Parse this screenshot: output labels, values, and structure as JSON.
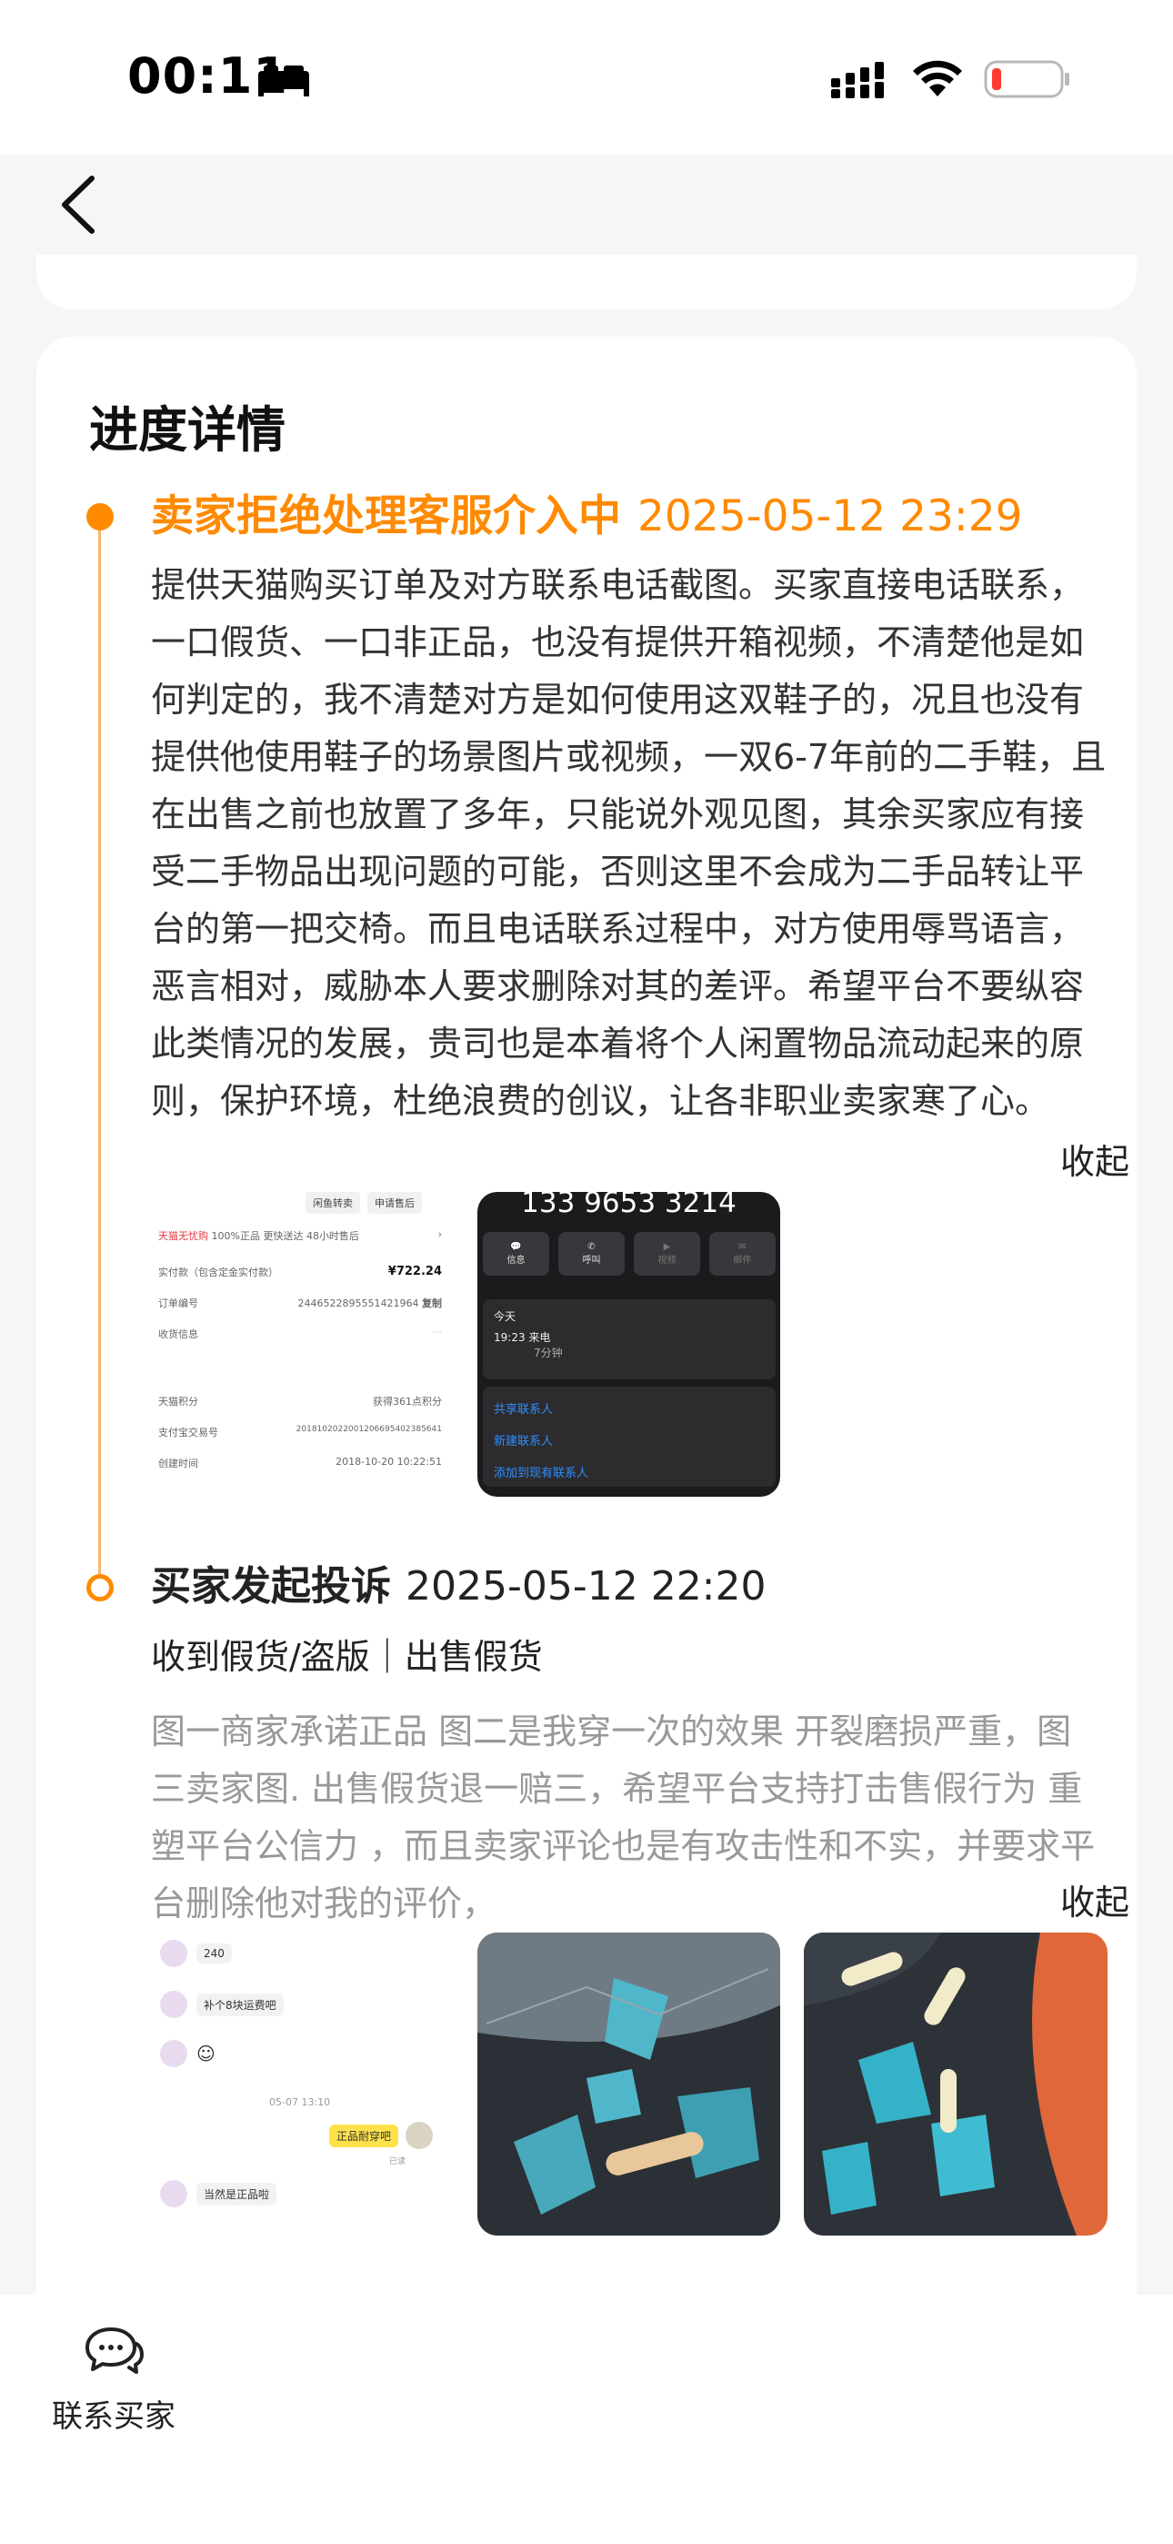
{
  "status_bar": {
    "time": "00:11"
  },
  "section": {
    "title": "进度详情"
  },
  "events": [
    {
      "title": "卖家拒绝处理客服介入中",
      "date": "2025-05-12 23:29",
      "body": "提供天猫购买订单及对方联系电话截图。买家直接电话联系，一口假货、一口非正品，也没有提供开箱视频，不清楚他是如何判定的，我不清楚对方是如何使用这双鞋子的，况且也没有提供他使用鞋子的场景图片或视频，一双6-7年前的二手鞋，且在出售之前也放置了多年，只能说外观见图，其余买家应有接受二手物品出现问题的可能，否则这里不会成为二手品转让平台的第一把交椅。而且电话联系过程中，对方使用辱骂语言，恶言相对，威胁本人要求删除对其的差评。希望平台不要纵容此类情况的发展，贵司也是本着将个人闲置物品流动起来的原则，保护环境，杜绝浪费的创议，让各非职业卖家寒了心。",
      "collapse_label": "收起",
      "order_thumb": {
        "tab_1": "闲鱼转卖",
        "tab_2": "申请售后",
        "shop": "天猫无忧购",
        "shop_note": "100%正品 更快送达 48小时售后",
        "paid_label": "实付款（包含定金实付款）",
        "paid_value": "¥722.24",
        "order_no_label": "订单编号",
        "order_no_value": "2446522895551421964",
        "copy": "复制",
        "address_label": "收货信息",
        "points_label": "天猫积分",
        "points_value": "获得361点积分",
        "alipay_label": "支付宝交易号",
        "alipay_value": "2018102022001206695402385641",
        "created_label": "创建时间",
        "created_value": "2018-10-20 10:22:51"
      },
      "phone_thumb": {
        "number": "133 9653 3214",
        "btn_message": "信息",
        "btn_call": "呼叫",
        "btn_video": "视频",
        "btn_mail": "邮件",
        "today": "今天",
        "call_time": "19:23",
        "call_type": "来电",
        "call_duration": "7分钟",
        "action_1": "共享联系人",
        "action_2": "新建联系人",
        "action_3": "添加到现有联系人"
      }
    },
    {
      "title": "买家发起投诉",
      "date": "2025-05-12 22:20",
      "reason": "收到假货/盗版｜出售假货",
      "body": "图一商家承诺正品 图二是我穿一次的效果 开裂磨损严重，图三卖家图. 出售假货退一赔三，希望平台支持打击售假行为 重塑平台公信力 ，而且卖家评论也是有攻击性和不实，并要求平台删除他对我的评价，",
      "collapse_label": "收起",
      "chat_thumb": {
        "msg_1": "240",
        "msg_2": "补个8块运费吧",
        "stamp": "05-07 13:10",
        "mine": "正品耐穿吧",
        "read": "已读",
        "msg_4": "当然是正品啦"
      }
    }
  ],
  "bottom_bar": {
    "contact_label": "联系买家"
  },
  "colors": {
    "accent": "#ff8a00",
    "muted_text": "#999999"
  }
}
